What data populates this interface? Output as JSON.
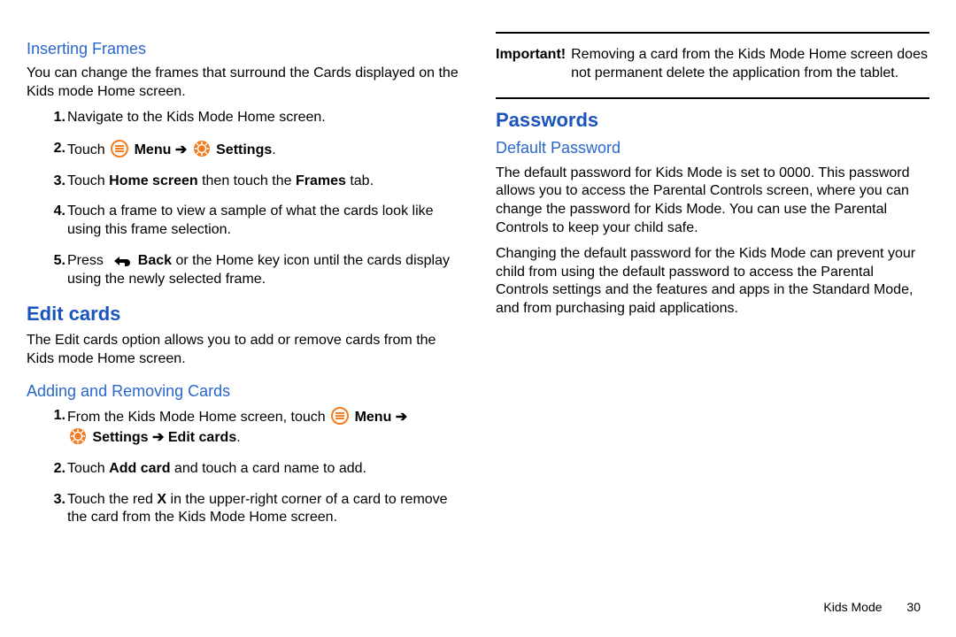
{
  "left": {
    "inserting_frames": {
      "heading": "Inserting Frames",
      "intro": "You can change the frames that surround the Cards displayed on the Kids mode Home screen.",
      "steps": {
        "s1": "Navigate to the Kids Mode Home screen.",
        "s2_a": "Touch ",
        "s2_menu": " Menu ",
        "s2_arrow": "➔",
        "s2_settings": " Settings",
        "s2_dot": ".",
        "s3_a": "Touch ",
        "s3_b": "Home screen",
        "s3_c": " then touch the ",
        "s3_d": "Frames",
        "s3_e": " tab.",
        "s4": "Touch a frame to view a sample of what the cards look like using this frame selection.",
        "s5_a": "Press ",
        "s5_back": " Back",
        "s5_b": " or the Home key icon until the cards display using the newly selected frame."
      }
    },
    "edit_cards": {
      "heading": "Edit cards",
      "intro": "The Edit cards option allows you to add or remove cards from the Kids mode Home screen.",
      "adding_heading": "Adding and Removing Cards",
      "steps": {
        "s1_a": "From the Kids Mode Home screen, touch ",
        "s1_menu": " Menu ",
        "s1_arrow": "➔",
        "s1_settings": " Settings ",
        "s1_arrow2": "➔",
        "s1_edit": " Edit cards",
        "s1_dot": ".",
        "s2_a": "Touch ",
        "s2_b": "Add card",
        "s2_c": " and touch a card name to add.",
        "s3_a": "Touch the red ",
        "s3_b": "X",
        "s3_c": " in the upper-right corner of a card to remove the card from the Kids Mode Home screen."
      }
    }
  },
  "right": {
    "important": {
      "label": "Important!",
      "text": "Removing a card from the Kids Mode Home screen does not permanent delete the application from the tablet."
    },
    "passwords": {
      "heading": "Passwords",
      "default_heading": "Default Password",
      "p1": "The default password for Kids Mode is set to 0000. This password allows you to access the Parental Controls screen, where you can change the password for Kids Mode. You can use the Parental Controls to keep your child safe.",
      "p2": "Changing the default password for the Kids Mode can prevent your child from using the default password to access the Parental Controls settings and the features and apps in the Standard Mode, and from purchasing paid applications."
    }
  },
  "footer": {
    "section": "Kids Mode",
    "page": "30"
  }
}
